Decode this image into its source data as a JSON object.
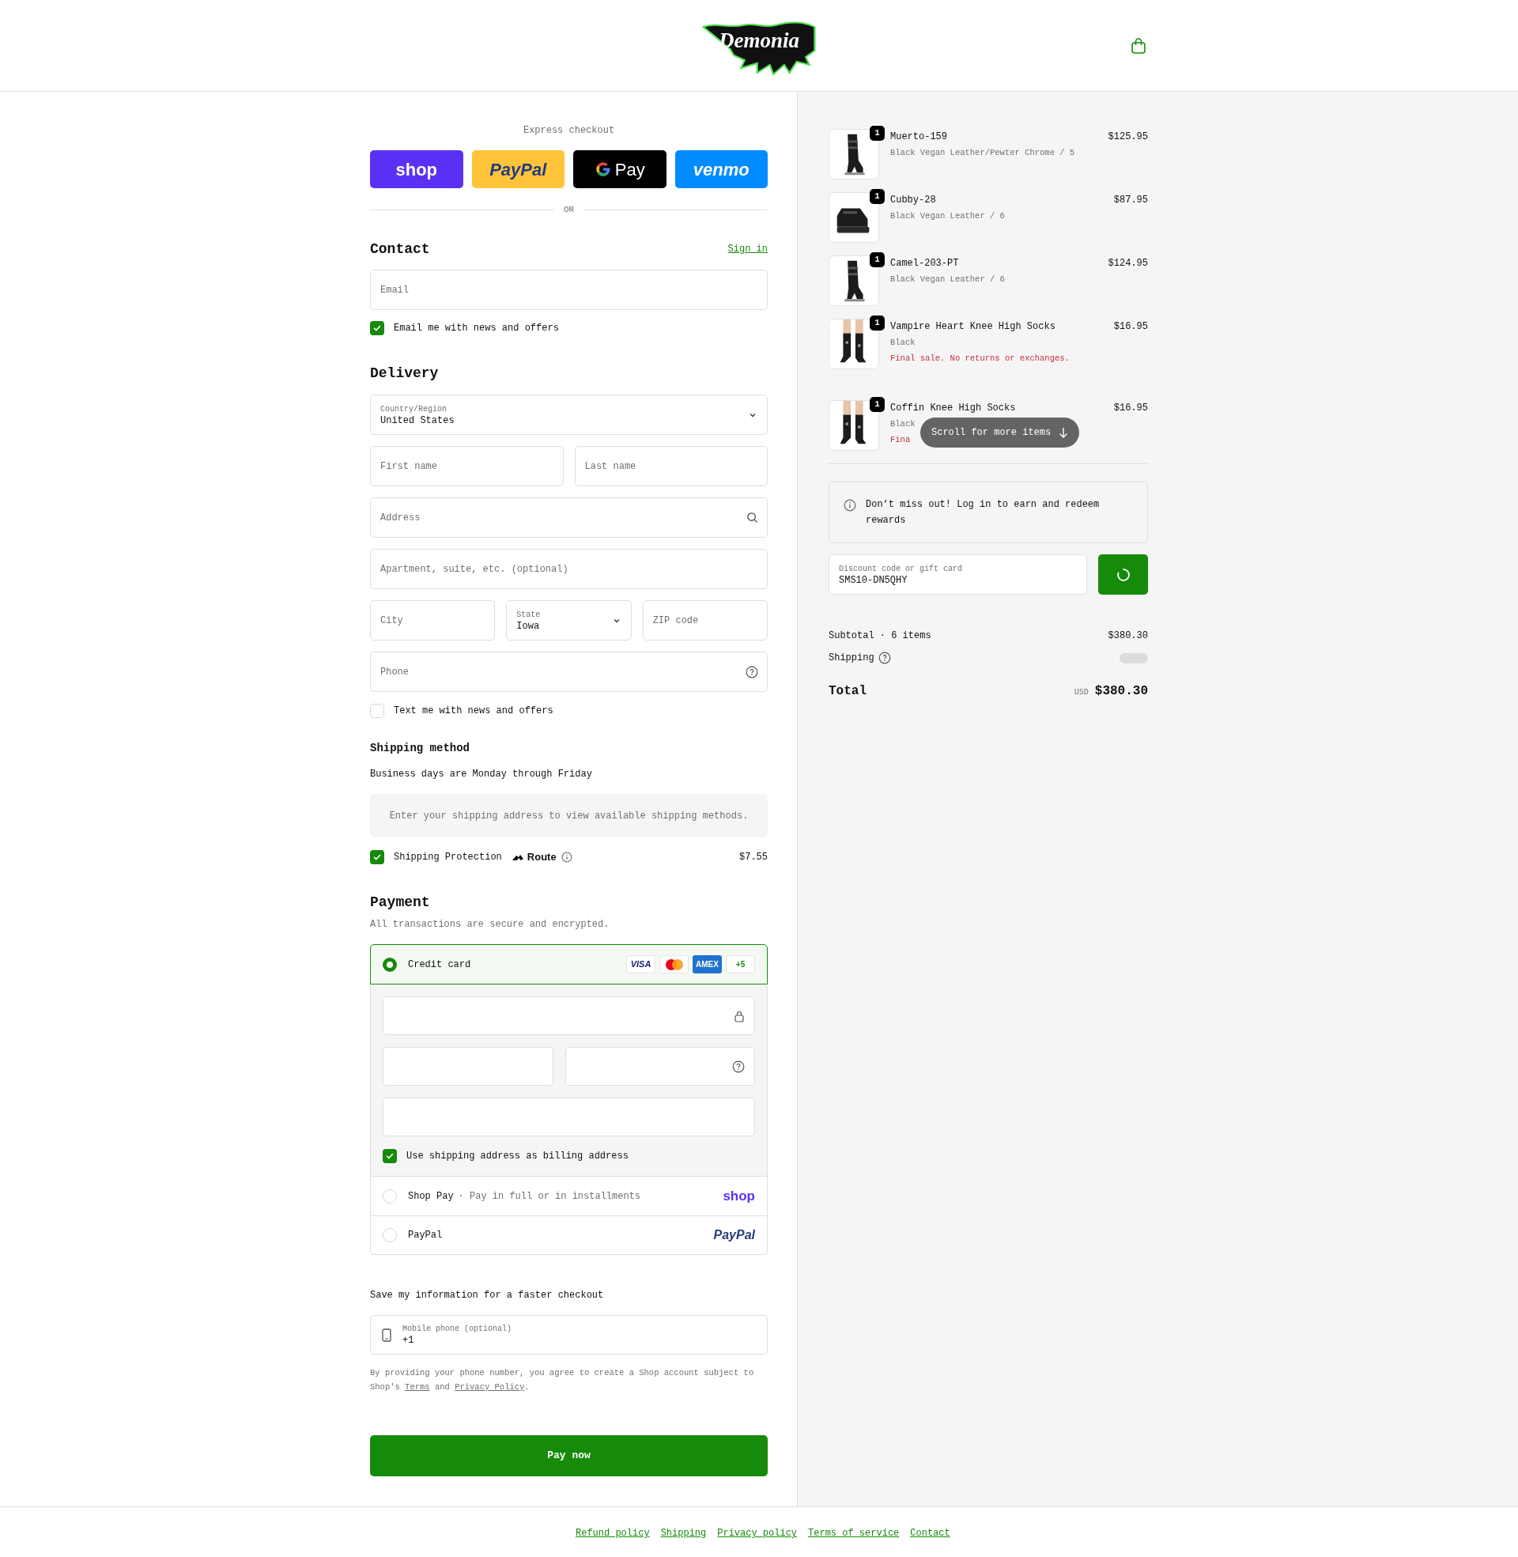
{
  "header": {
    "logo_text": "Demonia"
  },
  "express": {
    "label": "Express checkout",
    "divider": "OR",
    "buttons": [
      {
        "kind": "shop",
        "label": "shop"
      },
      {
        "kind": "paypal",
        "label": "PayPal"
      },
      {
        "kind": "gpay",
        "label": "Pay"
      },
      {
        "kind": "venmo",
        "label": "venmo"
      }
    ]
  },
  "contact": {
    "title": "Contact",
    "sign_in": "Sign in",
    "email": {
      "placeholder": "Email"
    },
    "marketing": {
      "label": "Email me with news and offers",
      "checked": true
    }
  },
  "delivery": {
    "title": "Delivery",
    "country": {
      "label": "Country/Region",
      "value": "United States"
    },
    "first_name": {
      "placeholder": "First name"
    },
    "last_name": {
      "placeholder": "Last name"
    },
    "address": {
      "placeholder": "Address"
    },
    "apartment": {
      "placeholder": "Apartment, suite, etc. (optional)"
    },
    "city": {
      "placeholder": "City"
    },
    "state": {
      "label": "State",
      "value": "Iowa"
    },
    "zip": {
      "placeholder": "ZIP code"
    },
    "phone": {
      "placeholder": "Phone"
    },
    "sms": {
      "label": "Text me with news and offers",
      "checked": false
    }
  },
  "shipping_method": {
    "title": "Shipping method",
    "note": "Business days are Monday through Friday",
    "empty_message": "Enter your shipping address to view available shipping methods.",
    "protection": {
      "checked": true,
      "label": "Shipping Protection",
      "brand": "Route",
      "price": "$7.55"
    }
  },
  "payment": {
    "title": "Payment",
    "subtitle": "All transactions are secure and encrypted.",
    "methods": [
      {
        "kind": "card",
        "label": "Credit card",
        "selected": true,
        "brands": [
          {
            "kind": "visa",
            "text": "VISA"
          },
          {
            "kind": "mastercard"
          },
          {
            "kind": "amex",
            "text": "AMEX"
          },
          {
            "kind": "more",
            "text": "+5"
          }
        ],
        "billing_same": {
          "label": "Use shipping address as billing address",
          "checked": true
        }
      },
      {
        "kind": "shop_pay",
        "label": "Shop Pay",
        "detail": "· Pay in full or in installments",
        "logo": "shop",
        "selected": false
      },
      {
        "kind": "paypal",
        "label": "PayPal",
        "logo": "PayPal",
        "selected": false
      }
    ]
  },
  "save_info": {
    "title": "Save my information for a faster checkout",
    "mobile": {
      "label": "Mobile phone (optional)",
      "value": "+1"
    },
    "disclaimer": {
      "text": "By providing your phone number, you agree to create a Shop account subject to Shop's ",
      "terms": "Terms",
      "and": " and ",
      "privacy": "Privacy Policy",
      "end": "."
    }
  },
  "pay_button": "Pay now",
  "footer_links": [
    "Refund policy",
    "Shipping",
    "Privacy policy",
    "Terms of service",
    "Contact"
  ],
  "order": {
    "items": [
      {
        "name": "Muerto-159",
        "variant": "Black Vegan Leather/Pewter Chrome / 5",
        "price": "$125.95",
        "quantity": "1",
        "kind": "boot"
      },
      {
        "name": "Cubby-28",
        "variant": "Black Vegan Leather / 6",
        "price": "$87.95",
        "quantity": "1",
        "kind": "shoe"
      },
      {
        "name": "Camel-203-PT",
        "variant": "Black Vegan Leather / 6",
        "price": "$124.95",
        "quantity": "1",
        "kind": "boot"
      },
      {
        "name": "Vampire Heart Knee High Socks",
        "variant": "Black",
        "note": "Final sale. No returns or exchanges.",
        "price": "$16.95",
        "quantity": "1",
        "kind": "socks"
      },
      {
        "name": "Coffin Knee High Socks",
        "variant": "Black",
        "note": "Fina",
        "price": "$16.95",
        "quantity": "1",
        "kind": "socks"
      }
    ],
    "scroll_hint": "Scroll for more items",
    "rewards": "Don’t miss out! Log in to earn and redeem rewards",
    "discount": {
      "label": "Discount code or gift card",
      "value": "SMS10-DN5QHY"
    },
    "subtotal_label": "Subtotal · 6 items",
    "subtotal": "$380.30",
    "shipping_label": "Shipping",
    "total_label": "Total",
    "currency": "USD",
    "total": "$380.30"
  }
}
